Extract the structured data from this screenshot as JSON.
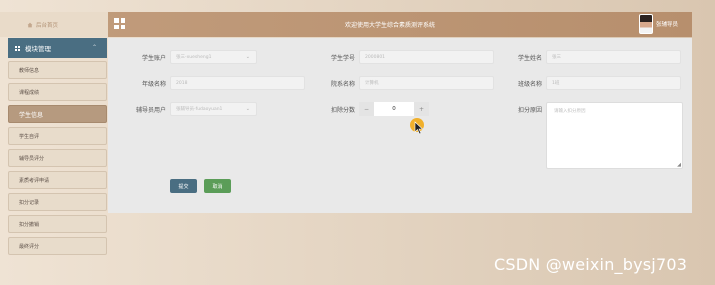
{
  "header": {
    "home_label": "后台首页",
    "title": "欢迎使用大学生综合素质测评系统",
    "user_name": "张辅导员"
  },
  "sidebar": {
    "module_label": "模块管理",
    "items": [
      {
        "label": "教师信息",
        "active": false
      },
      {
        "label": "课程成绩",
        "active": false
      },
      {
        "label": "学生信息",
        "active": true
      },
      {
        "label": "学生自评",
        "active": false
      },
      {
        "label": "辅导员评分",
        "active": false
      },
      {
        "label": "素质考评申请",
        "active": false
      },
      {
        "label": "扣分记录",
        "active": false
      },
      {
        "label": "扣分撤销",
        "active": false
      },
      {
        "label": "最终评分",
        "active": false
      }
    ]
  },
  "form": {
    "student_account": {
      "label": "学生账户",
      "value": "张三-xuesheng1"
    },
    "student_number": {
      "label": "学生学号",
      "value": "2000801"
    },
    "student_name": {
      "label": "学生姓名",
      "value": "张三"
    },
    "grade_name": {
      "label": "年级名称",
      "value": "2018"
    },
    "department_name": {
      "label": "院系名称",
      "value": "计算机"
    },
    "class_name": {
      "label": "班级名称",
      "value": "1班"
    },
    "counselor_user": {
      "label": "辅导员用户",
      "value": "张辅导员-fudaoyuan1"
    },
    "deduct_points": {
      "label": "扣除分数",
      "value": "0",
      "minus": "−",
      "plus": "+"
    },
    "deduct_reason": {
      "label": "扣分原因",
      "placeholder": "请输入扣分原因"
    }
  },
  "buttons": {
    "submit": "提交",
    "cancel": "取消"
  },
  "watermark": "CSDN @weixin_bysj703"
}
